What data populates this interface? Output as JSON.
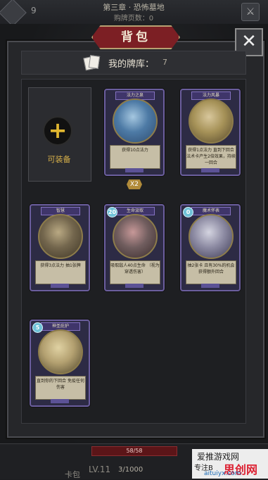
{
  "top": {
    "left_count": "9",
    "chapter": "第三章 · 恐怖墓地",
    "card_count": "购牌页数：0"
  },
  "panel": {
    "title": "背包",
    "close": "✕",
    "deck_label": "我的牌库：",
    "deck_count": "7",
    "equip_label": "可装备",
    "x2": "X2"
  },
  "cards": [
    {
      "name": "法力之泉",
      "desc": "获得10点法力",
      "cost": "",
      "art": [
        "#4d7aa5",
        "#a5c7e0",
        "#2e4b6f"
      ]
    },
    {
      "name": "法力风暴",
      "desc": "获得1点法力 直到下回合 法术卡产生2倍效果，持续一回合",
      "cost": "",
      "art": [
        "#a69258",
        "#d8c79c",
        "#54472c"
      ]
    },
    {
      "name": "智慧",
      "desc": "获得3点法力 抽1张牌",
      "cost": "",
      "art": [
        "#73664d",
        "#b9a983",
        "#3f3626"
      ]
    },
    {
      "name": "生命汲取",
      "desc": "吸取敌人40点生命 （视为穿透伤害）",
      "cost": "20",
      "art": [
        "#705d5e",
        "#c79898",
        "#3a2b2c"
      ]
    },
    {
      "name": "魔术怀表",
      "desc": "抽2张卡 且有30%的机会 获得额外回合",
      "cost": "0",
      "art": [
        "#8c8aa2",
        "#d4d4e0",
        "#3e3b55"
      ]
    },
    {
      "name": "神圣庇护",
      "desc": "直到你的下回合 免疫任何伤害",
      "cost": "5",
      "art": [
        "#b3a070",
        "#e0d2a3",
        "#4c432a"
      ]
    }
  ],
  "bottom": {
    "hp": "58/58",
    "bag": "卡包",
    "lv": "LV.11",
    "xp": "3/1000"
  },
  "watermark": {
    "line1": "爱推游戏网",
    "line2": "专注B",
    "line3": "思创网",
    "line4": "aituiyx.com"
  }
}
